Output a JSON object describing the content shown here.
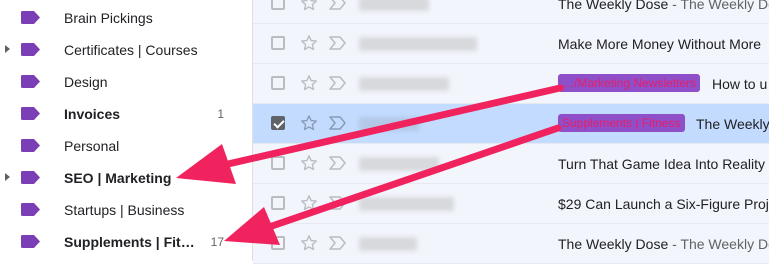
{
  "sidebar": {
    "items": [
      {
        "label": "Brain Pickings",
        "count": "",
        "bold": false,
        "expand": false
      },
      {
        "label": "Certificates | Courses",
        "count": "",
        "bold": false,
        "expand": true
      },
      {
        "label": "Design",
        "count": "",
        "bold": false,
        "expand": false
      },
      {
        "label": "Invoices",
        "count": "1",
        "bold": true,
        "expand": false
      },
      {
        "label": "Personal",
        "count": "",
        "bold": false,
        "expand": false
      },
      {
        "label": "SEO | Marketing",
        "count": "",
        "bold": true,
        "expand": true
      },
      {
        "label": "Startups | Business",
        "count": "",
        "bold": false,
        "expand": false
      },
      {
        "label": "Supplements | Fit…",
        "count": "17",
        "bold": true,
        "expand": false
      }
    ],
    "label_color": "#7b3fb5"
  },
  "mail": {
    "rows": [
      {
        "subject": "The Weekly Dose",
        "snippet": " - The Weekly Do",
        "chip": "",
        "selected": false
      },
      {
        "subject": "Make More Money Without More",
        "snippet": "",
        "chip": "",
        "selected": false
      },
      {
        "subject": "How to u",
        "snippet": "",
        "chip": "…/Marketing Newsletters",
        "selected": false
      },
      {
        "subject": "The Weekly",
        "snippet": "",
        "chip": "Supplements | Fitness",
        "selected": true
      },
      {
        "subject": "Turn That Game Idea Into Reality",
        "snippet": "",
        "chip": "",
        "selected": false
      },
      {
        "subject": "$29 Can Launch a Six-Figure Proj",
        "snippet": "",
        "chip": "",
        "selected": false
      },
      {
        "subject": "The Weekly Dose",
        "snippet": " - The Weekly Do",
        "chip": "",
        "selected": false
      }
    ]
  },
  "colors": {
    "arrow": "#f0235f",
    "chip_bg": "#8e4fc8",
    "chip_text": "#e61f6b",
    "selected_row": "#c2dbff"
  }
}
